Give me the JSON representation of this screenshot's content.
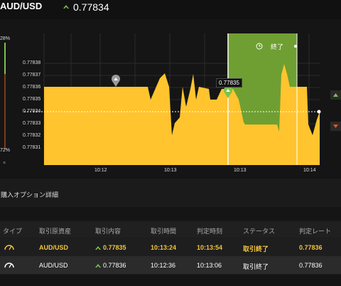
{
  "header": {
    "pair": "AUD/USD",
    "current_price": "0.77834",
    "trend_icon": "up-arrow-icon"
  },
  "ratio": {
    "top": "28%",
    "bottom": "72%",
    "close": "×"
  },
  "chart_data": {
    "type": "area",
    "y_ticks": [
      "0.77838",
      "0.77837",
      "0.77836",
      "0.77835",
      "0.77834",
      "0.77833",
      "0.77832",
      "0.77831"
    ],
    "x_ticks": [
      "10:12",
      "10:13",
      "10:13",
      "10:14"
    ],
    "current_level": 0.77834,
    "entry_price_label": "0.77835",
    "expiry_label": "終了",
    "colors": {
      "area": "#ffc42e",
      "zone": "#6f9f32",
      "line": "#ffffff"
    }
  },
  "details": {
    "title": "購入オプション詳細"
  },
  "table": {
    "headers": [
      "タイプ",
      "取引原資産",
      "取引内容",
      "取引時間",
      "判定時刻",
      "ステータス",
      "判定レート"
    ],
    "rows": [
      {
        "asset": "AUD/USD",
        "content": "0.77835",
        "time": "10:13:24",
        "judge_time": "10:13:54",
        "status": "取引終了",
        "rate": "0.77836",
        "style": "gold"
      },
      {
        "asset": "AUD/USD",
        "content": "0.77836",
        "time": "10:12:36",
        "judge_time": "10:13:06",
        "status": "取引終了",
        "rate": "0.77836",
        "style": "white"
      }
    ]
  }
}
